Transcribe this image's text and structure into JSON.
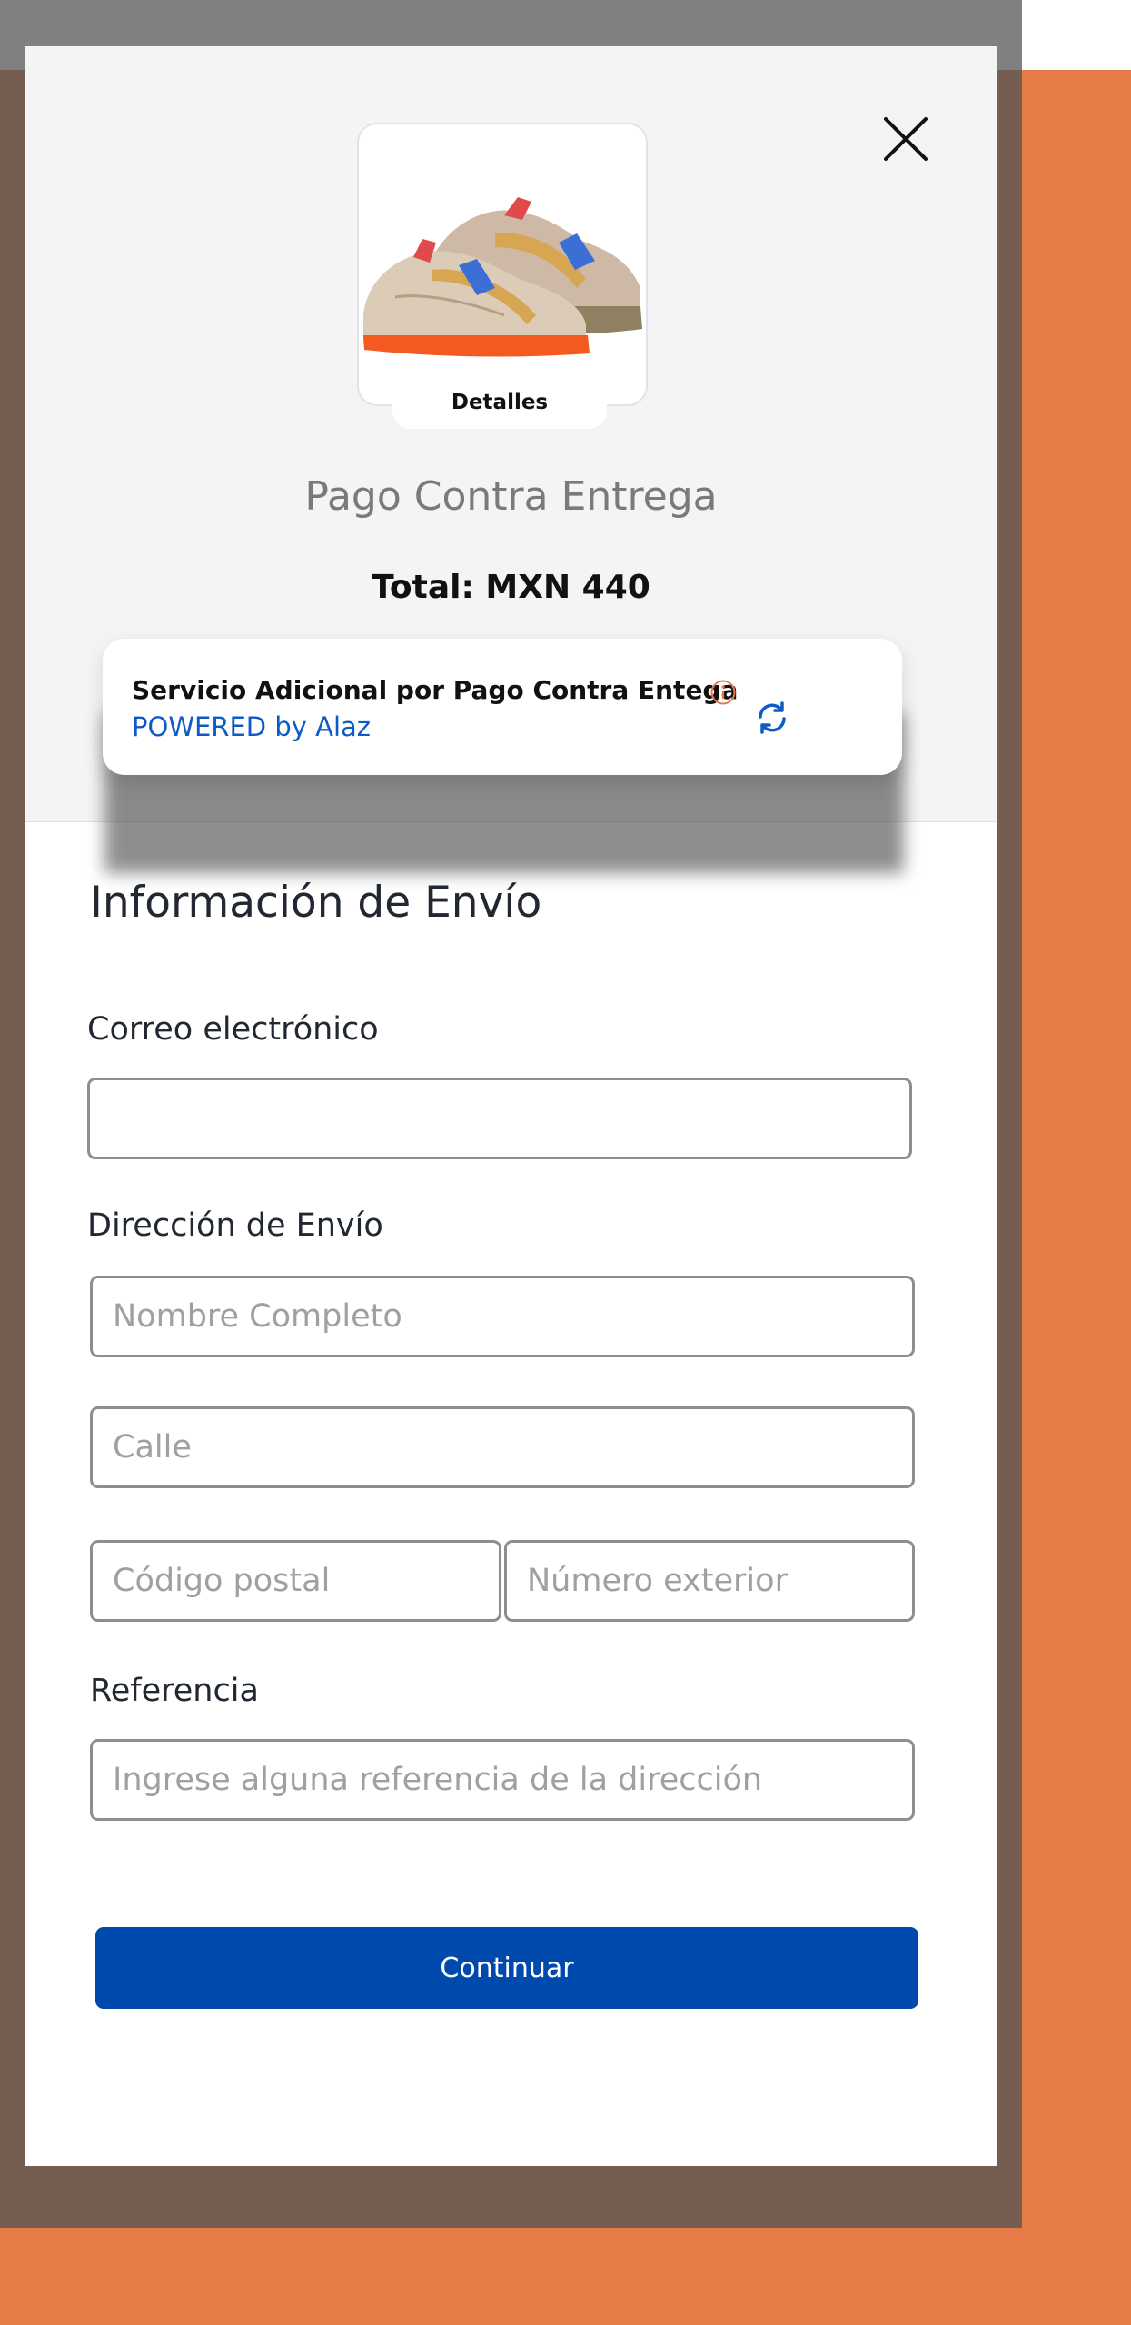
{
  "product": {
    "details_label": "Detalles",
    "image_icon": "sneakers-image"
  },
  "header": {
    "title": "Pago Contra Entrega",
    "total": "Total: MXN 440"
  },
  "service": {
    "title": "Servicio Adicional por Pago Contra Entega",
    "powered": "POWERED by Alaz",
    "info_icon": "info-icon",
    "refresh_icon": "refresh-icon"
  },
  "form": {
    "section_title": "Información de Envío",
    "email_label": "Correo electrónico",
    "email_value": "",
    "address_label": "Dirección de Envío",
    "full_name_placeholder": "Nombre Completo",
    "street_placeholder": "Calle",
    "postal_code_placeholder": "Código postal",
    "exterior_number_placeholder": "Número exterior",
    "reference_label": "Referencia",
    "reference_placeholder": "Ingrese alguna referencia de la dirección",
    "continue_label": "Continuar"
  },
  "colors": {
    "accent": "#004AAD",
    "link": "#0D5BC6",
    "info": "#E67B48",
    "page_background": "#E67B48",
    "overlay": "#765D52"
  }
}
